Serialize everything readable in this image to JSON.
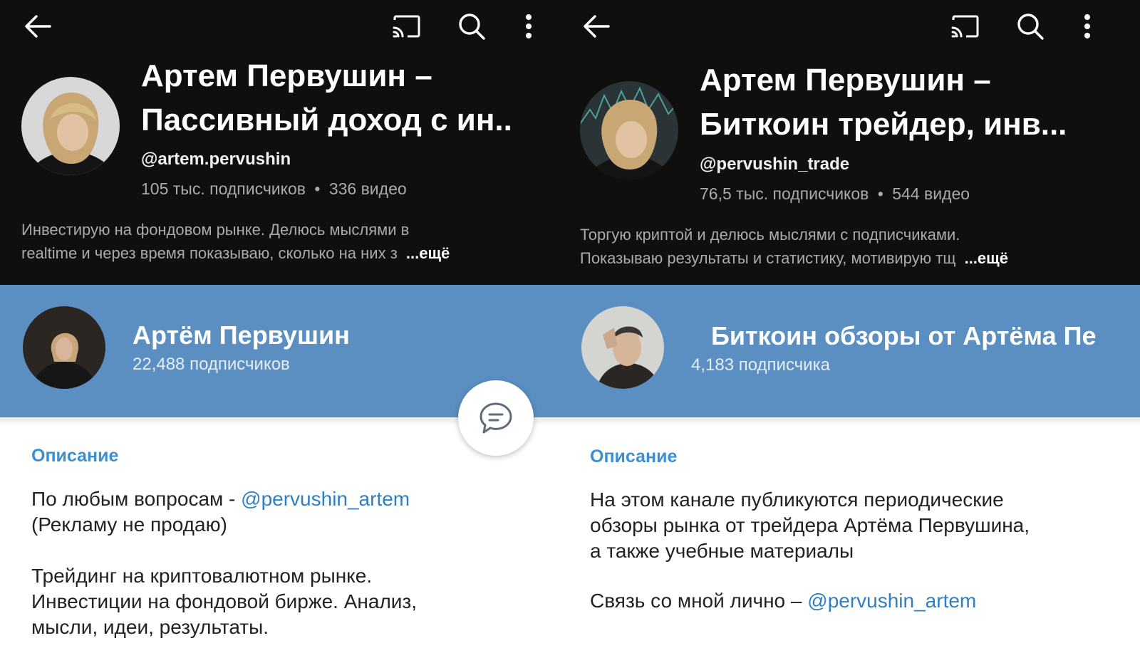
{
  "left": {
    "youtube": {
      "title_line1": "Артем Первушин –",
      "title_line2": "Пассивный доход с ин..",
      "handle": "@artem.pervushin",
      "subscribers": "105 тыс. подписчиков",
      "videos": "336 видео",
      "description_line1": "Инвестирую на фондовом рынке. Делюсь мыслями в",
      "description_line2": "realtime и через время показываю, сколько на них з",
      "more": "...ещё"
    },
    "telegram": {
      "name": "Артём Первушин",
      "subscribers": "22,488 подписчиков",
      "section_title": "Описание",
      "desc_p1_text": "По любым вопросам - ",
      "desc_p1_link": "@pervushin_artem",
      "desc_p1_line2": "(Рекламу не продаю)",
      "desc_p2_line1": "Трейдинг на криптовалютном рынке.",
      "desc_p2_line2": "Инвестиции на фондовой бирже. Анализ,",
      "desc_p2_line3": "мысли, идеи, результаты."
    }
  },
  "right": {
    "youtube": {
      "title_line1": "Артем Первушин –",
      "title_line2": "Биткоин трейдер, инв...",
      "handle": "@pervushin_trade",
      "subscribers": "76,5 тыс. подписчиков",
      "videos": "544 видео",
      "description_line1": "Торгую криптой и делюсь мыслями с подписчиками.",
      "description_line2": "Показываю результаты и статистику, мотивирую тщ",
      "more": "...ещё"
    },
    "telegram": {
      "name": "Биткоин обзоры от Артёма Пе",
      "subscribers": "4,183 подписчика",
      "section_title": "Описание",
      "desc_p1_line1": "На этом канале публикуются периодические",
      "desc_p1_line2": "обзоры рынка от трейдера Артёма Первушина,",
      "desc_p1_line3": "а также учебные материалы",
      "desc_p2_text": "Связь со мной лично – ",
      "desc_p2_link": "@pervushin_artem"
    }
  },
  "separator": "•",
  "icons": [
    "back-arrow-icon",
    "cast-icon",
    "search-icon",
    "more-vert-icon",
    "comment-icon"
  ],
  "colors": {
    "youtube_bg": "#0f0f0f",
    "telegram_header": "#5b8fc2",
    "telegram_accent": "#3d8fd1",
    "link": "#2f7fc4"
  }
}
